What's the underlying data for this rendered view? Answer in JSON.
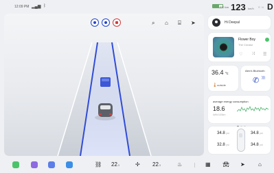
{
  "status_bar": {
    "time": "12:09 PM",
    "signal_icon": "signal-bars-icon",
    "bluetooth_icon": "bluetooth-icon",
    "battery_percent": 65,
    "range": "270 km",
    "speed": "123",
    "speed_unit": "km/h",
    "gear_options": "R N",
    "gear": "D"
  },
  "map": {
    "top_buttons": [
      "assist-button",
      "voice-button",
      "record-button"
    ],
    "toolbar_icons": [
      "search-icon",
      "home-icon",
      "building-icon",
      "navigation-icon"
    ],
    "lane_accent": "#2f4bd8"
  },
  "user": {
    "greeting": "Hi Deepal"
  },
  "music": {
    "song": "Flower Boy",
    "artist": "The Creator",
    "accent": "#4cc36b"
  },
  "temperature": {
    "value": "36.4",
    "unit": "°c",
    "label": "outside"
  },
  "phone": {
    "device": "Alex's Bluetooth"
  },
  "energy": {
    "label": "average energy consumption",
    "value": "18.6",
    "unit": "kWh/100km"
  },
  "tires": {
    "front_left": "34.8",
    "front_right": "34.8",
    "rear_left": "32.8",
    "rear_right": "34.8",
    "unit": "psi"
  },
  "dock": {
    "apps": [
      "phone-app",
      "media-app",
      "calendar-app",
      "music-app"
    ],
    "left_temp": "22",
    "left_temp_decimal": ".5",
    "right_temp": "22",
    "right_temp_decimal": ".5",
    "app_colors": [
      "#4cc36b",
      "#8d6be0",
      "#5b7ee8",
      "#3a8ee6"
    ]
  }
}
